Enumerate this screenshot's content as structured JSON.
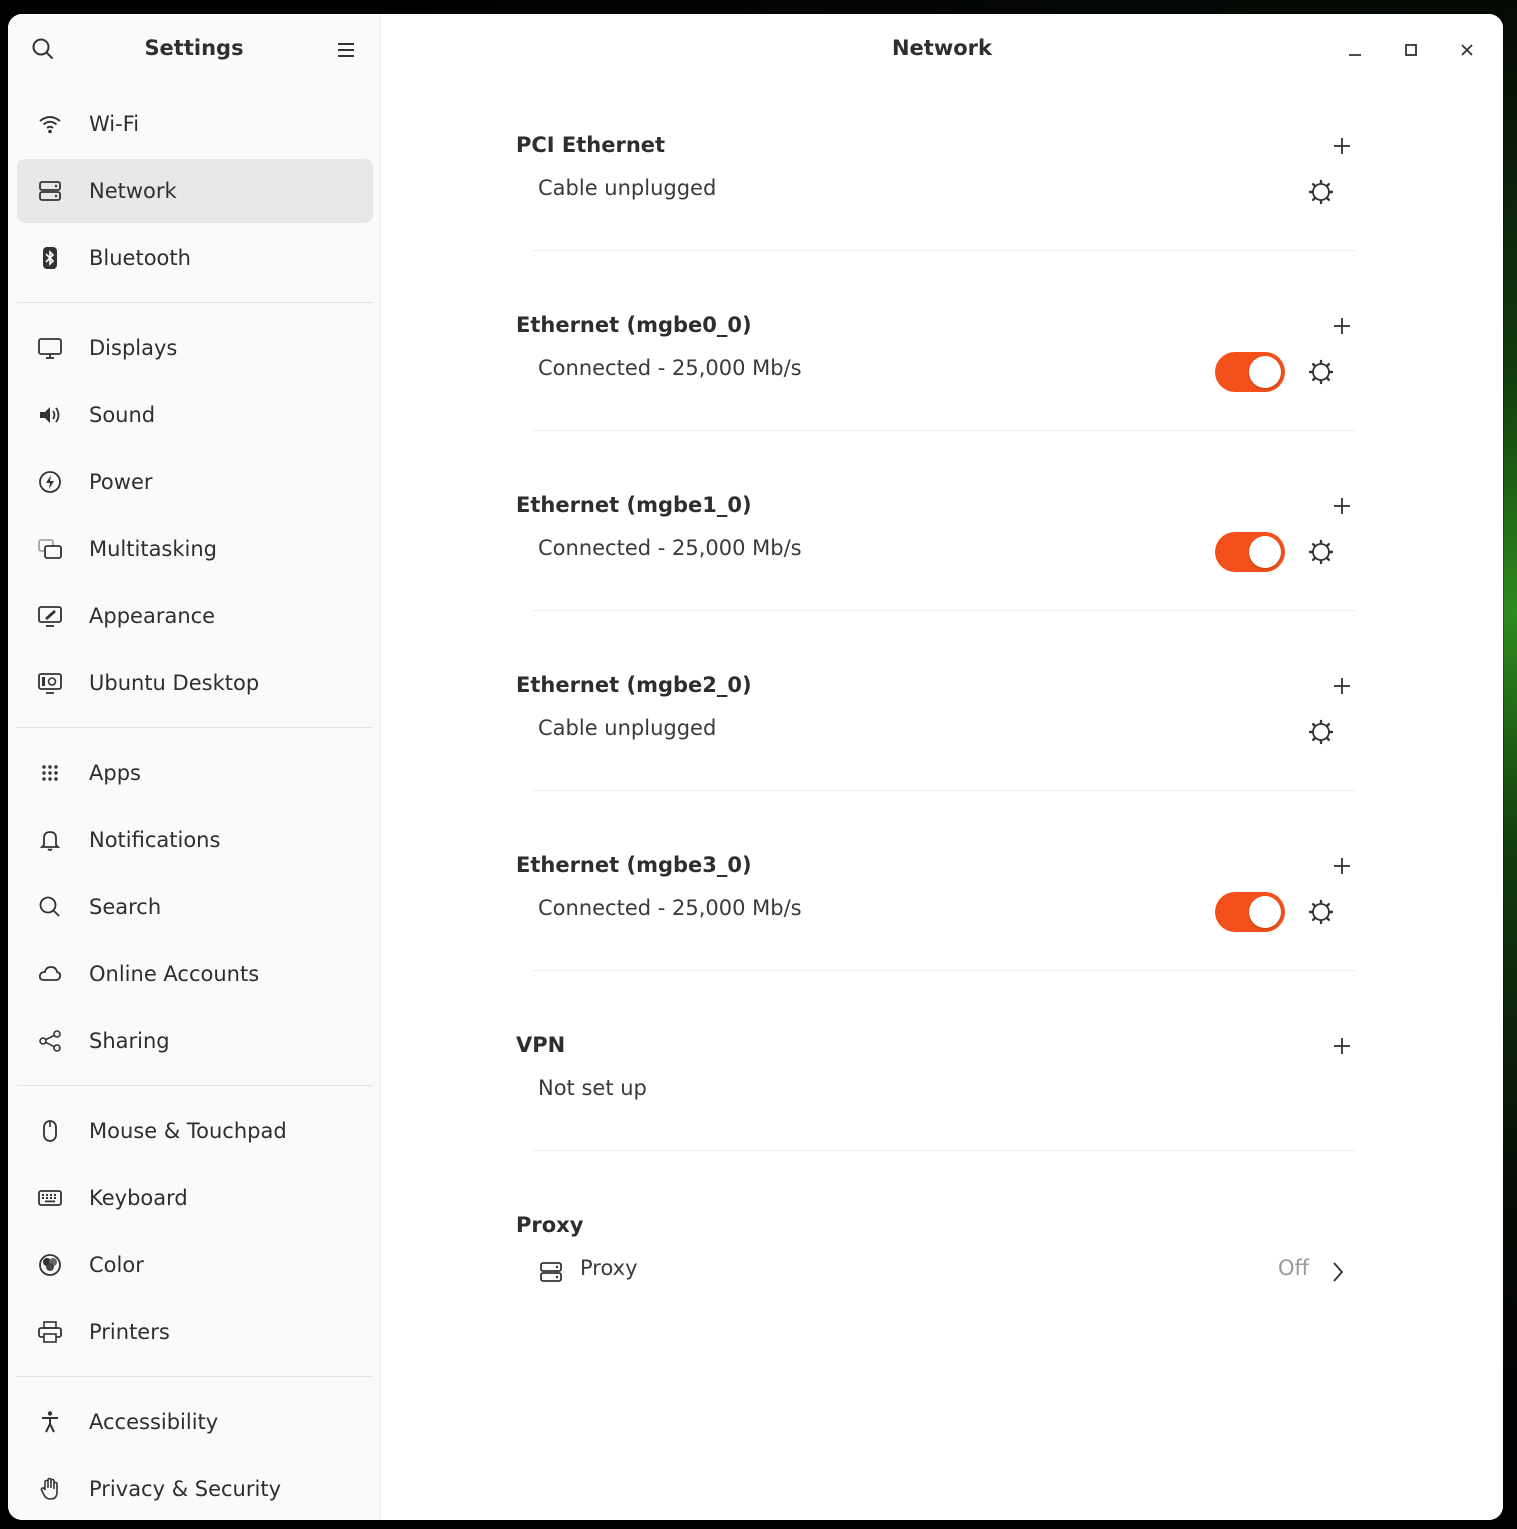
{
  "sidebar": {
    "title": "Settings",
    "search_icon": "search-icon",
    "menu_icon": "hamburger-menu-icon",
    "groups": [
      [
        {
          "label": "Wi-Fi",
          "icon": "wifi-icon",
          "active": false
        },
        {
          "label": "Network",
          "icon": "network-icon",
          "active": true
        },
        {
          "label": "Bluetooth",
          "icon": "bluetooth-icon",
          "active": false
        }
      ],
      [
        {
          "label": "Displays",
          "icon": "display-icon",
          "active": false
        },
        {
          "label": "Sound",
          "icon": "speaker-icon",
          "active": false
        },
        {
          "label": "Power",
          "icon": "power-icon",
          "active": false
        },
        {
          "label": "Multitasking",
          "icon": "multitasking-icon",
          "active": false
        },
        {
          "label": "Appearance",
          "icon": "appearance-icon",
          "active": false
        },
        {
          "label": "Ubuntu Desktop",
          "icon": "ubuntu-desktop-icon",
          "active": false
        }
      ],
      [
        {
          "label": "Apps",
          "icon": "apps-grid-icon",
          "active": false
        },
        {
          "label": "Notifications",
          "icon": "bell-icon",
          "active": false
        },
        {
          "label": "Search",
          "icon": "search-icon",
          "active": false
        },
        {
          "label": "Online Accounts",
          "icon": "cloud-icon",
          "active": false
        },
        {
          "label": "Sharing",
          "icon": "share-icon",
          "active": false
        }
      ],
      [
        {
          "label": "Mouse & Touchpad",
          "icon": "mouse-icon",
          "active": false
        },
        {
          "label": "Keyboard",
          "icon": "keyboard-icon",
          "active": false
        },
        {
          "label": "Color",
          "icon": "color-icon",
          "active": false
        },
        {
          "label": "Printers",
          "icon": "printer-icon",
          "active": false
        }
      ],
      [
        {
          "label": "Accessibility",
          "icon": "accessibility-icon",
          "active": false
        },
        {
          "label": "Privacy & Security",
          "icon": "hand-icon",
          "active": false
        }
      ]
    ]
  },
  "main": {
    "title": "Network",
    "window_controls": [
      "minimize-icon",
      "maximize-icon",
      "close-icon"
    ],
    "sections": [
      {
        "title": "PCI Ethernet",
        "status": "Cable unplugged",
        "has_toggle": false,
        "toggle_on": false
      },
      {
        "title": "Ethernet (mgbe0_0)",
        "status": "Connected - 25,000 Mb/s",
        "has_toggle": true,
        "toggle_on": true
      },
      {
        "title": "Ethernet (mgbe1_0)",
        "status": "Connected - 25,000 Mb/s",
        "has_toggle": true,
        "toggle_on": true
      },
      {
        "title": "Ethernet (mgbe2_0)",
        "status": "Cable unplugged",
        "has_toggle": false,
        "toggle_on": false
      },
      {
        "title": "Ethernet (mgbe3_0)",
        "status": "Connected - 25,000 Mb/s",
        "has_toggle": true,
        "toggle_on": true
      }
    ],
    "vpn": {
      "title": "VPN",
      "status": "Not set up"
    },
    "proxy": {
      "title": "Proxy",
      "label": "Proxy",
      "value": "Off"
    },
    "accent_color": "#f3501b"
  }
}
